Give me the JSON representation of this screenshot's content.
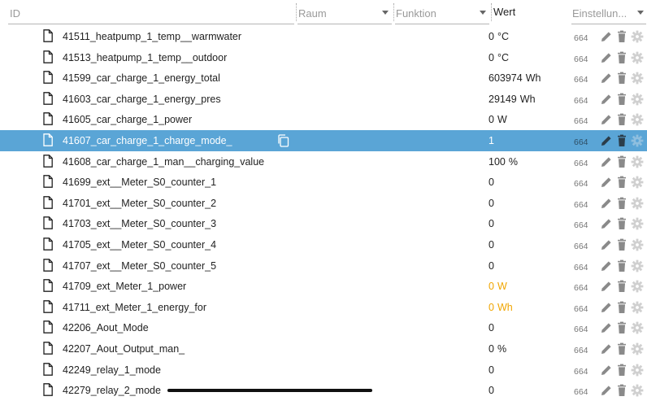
{
  "header": {
    "id_placeholder": "ID",
    "raum_label": "Raum",
    "funktion_label": "Funktion",
    "wert_label": "Wert",
    "settings_label": "Einstellun..."
  },
  "colors": {
    "selected_bg": "#5aa5d6",
    "warning_value": "#f0a500",
    "action_icon": "#8a8a8a"
  },
  "rows": [
    {
      "id": "41511_heatpump_1_temp__warmwater",
      "value": "0",
      "unit": "°C",
      "num": "664"
    },
    {
      "id": "41513_heatpump_1_temp__outdoor",
      "value": "0",
      "unit": "°C",
      "num": "664"
    },
    {
      "id": "41599_car_charge_1_energy_total",
      "value": "603974",
      "unit": "Wh",
      "num": "664"
    },
    {
      "id": "41603_car_charge_1_energy_pres",
      "value": "29149",
      "unit": "Wh",
      "num": "664"
    },
    {
      "id": "41605_car_charge_1_power",
      "value": "0",
      "unit": "W",
      "num": "664"
    },
    {
      "id": "41607_car_charge_1_charge_mode_",
      "value": "1",
      "unit": "",
      "num": "664",
      "selected": true
    },
    {
      "id": "41608_car_charge_1_man__charging_value",
      "value": "100",
      "unit": "%",
      "num": "664"
    },
    {
      "id": "41699_ext__Meter_S0_counter_1",
      "value": "0",
      "unit": "",
      "num": "664"
    },
    {
      "id": "41701_ext__Meter_S0_counter_2",
      "value": "0",
      "unit": "",
      "num": "664"
    },
    {
      "id": "41703_ext__Meter_S0_counter_3",
      "value": "0",
      "unit": "",
      "num": "664"
    },
    {
      "id": "41705_ext__Meter_S0_counter_4",
      "value": "0",
      "unit": "",
      "num": "664"
    },
    {
      "id": "41707_ext__Meter_S0_counter_5",
      "value": "0",
      "unit": "",
      "num": "664"
    },
    {
      "id": "41709_ext_Meter_1_power",
      "value": "0",
      "unit": "W",
      "num": "664",
      "warn": true
    },
    {
      "id": "41711_ext_Meter_1_energy_for",
      "value": "0",
      "unit": "Wh",
      "num": "664",
      "warn": true
    },
    {
      "id": "42206_Aout_Mode",
      "value": "0",
      "unit": "",
      "num": "664"
    },
    {
      "id": "42207_Aout_Output_man_",
      "value": "0",
      "unit": "%",
      "num": "664"
    },
    {
      "id": "42249_relay_1_mode",
      "value": "0",
      "unit": "",
      "num": "664"
    },
    {
      "id": "42279_relay_2_mode",
      "value": "0",
      "unit": "",
      "num": "664"
    }
  ]
}
